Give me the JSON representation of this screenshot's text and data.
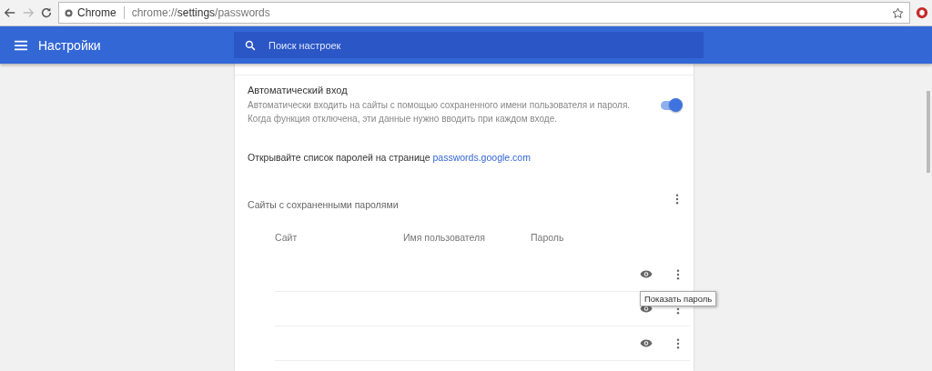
{
  "browser": {
    "tab_label": "Chrome",
    "url_host": "chrome://",
    "url_bold": "settings",
    "url_path": "/passwords",
    "bookmarked": false
  },
  "header": {
    "title": "Настройки",
    "search": {
      "placeholder": "Поиск настроек"
    }
  },
  "auto_signin": {
    "title": "Автоматический вход",
    "description": "Автоматически входить на сайты с помощью сохраненного имени пользователя и пароля. Когда функция отключена, эти данные нужно вводить при каждом входе.",
    "on": true
  },
  "passwords_link": {
    "text": "Открывайте список паролей на странице",
    "link": "passwords.google.com"
  },
  "saved": {
    "title": "Сайты с сохраненными паролями",
    "columns": [
      "Сайт",
      "Имя пользователя",
      "Пароль"
    ],
    "rows": [
      {
        "kind": "entry"
      },
      {
        "kind": "entry"
      },
      {
        "kind": "entry"
      }
    ]
  },
  "tooltip": "Показать пароль"
}
